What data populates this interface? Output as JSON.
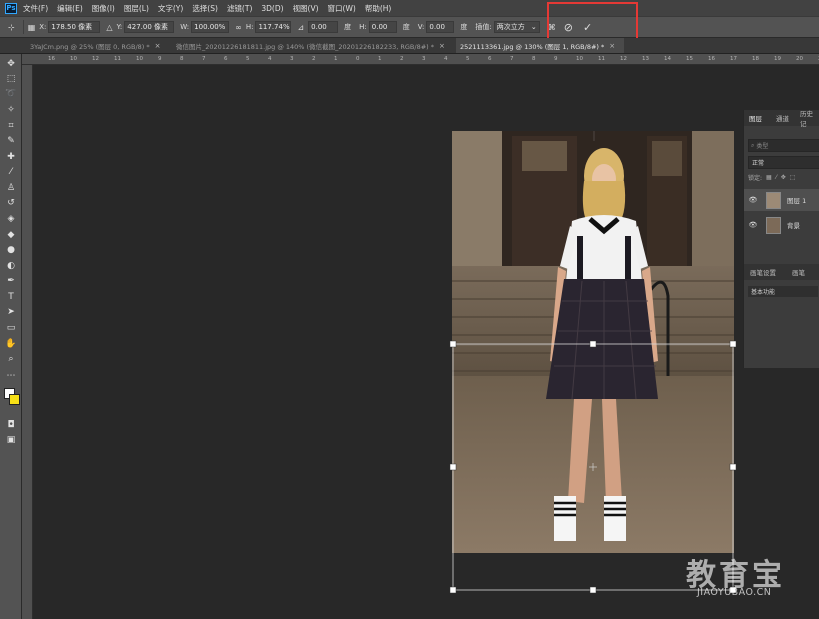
{
  "app": {
    "logo_text": "Ps"
  },
  "menu": [
    "文件(F)",
    "编辑(E)",
    "图像(I)",
    "图层(L)",
    "文字(Y)",
    "选择(S)",
    "滤镜(T)",
    "3D(D)",
    "视图(V)",
    "窗口(W)",
    "帮助(H)"
  ],
  "options": {
    "x_label": "X:",
    "x_value": "178.50 像素",
    "y_label": "Y:",
    "y_value": "427.00 像素",
    "w_label": "W:",
    "w_value": "100.00%",
    "h_label": "H:",
    "h_value": "117.74%",
    "angle_value": "0.00",
    "angle_unit": "度",
    "hskew_label": "H:",
    "hskew_value": "0.00",
    "hskew_unit": "度",
    "vskew_label": "V:",
    "vskew_value": "0.00",
    "vskew_unit": "度",
    "interp_label": "插值:",
    "interp_value": "两次立方",
    "cancel_icon": "cancel-circle-icon",
    "commit_icon": "checkmark-icon",
    "highlight_color": "#e53935"
  },
  "tabs": [
    {
      "title": "3YaJCm.png @ 25% (图层 0, RGB/8) *",
      "close": "×"
    },
    {
      "title": "微信图片_20201226181811.jpg @ 140% (微信截图_20201226182233, RGB/8#) *",
      "close": "×"
    },
    {
      "title": "2521113361.jpg @ 130% (图层 1, RGB/8#) *",
      "close": "×"
    }
  ],
  "ruler_ticks": [
    "16",
    "10",
    "12",
    "11",
    "10",
    "9",
    "8",
    "7",
    "6",
    "5",
    "4",
    "3",
    "2",
    "1",
    "0",
    "1",
    "2",
    "3",
    "4",
    "5",
    "6",
    "7",
    "8",
    "9",
    "10",
    "11",
    "12",
    "13",
    "14",
    "15",
    "16",
    "17",
    "18",
    "19",
    "20",
    "21"
  ],
  "layers_panel": {
    "tabs": [
      "图层",
      "通道",
      "历史记"
    ],
    "filter_placeholder": "类型",
    "blend_mode": "正常",
    "lock_label": "锁定:",
    "layers": [
      {
        "name": "图层 1",
        "visible": true
      },
      {
        "name": "背景",
        "visible": true
      }
    ],
    "sub_tabs": [
      "画笔设置",
      "画笔"
    ],
    "sub_item": "基本功能"
  },
  "watermark": {
    "main": "教育宝",
    "sub": "JIAOYUBAO.CN"
  }
}
